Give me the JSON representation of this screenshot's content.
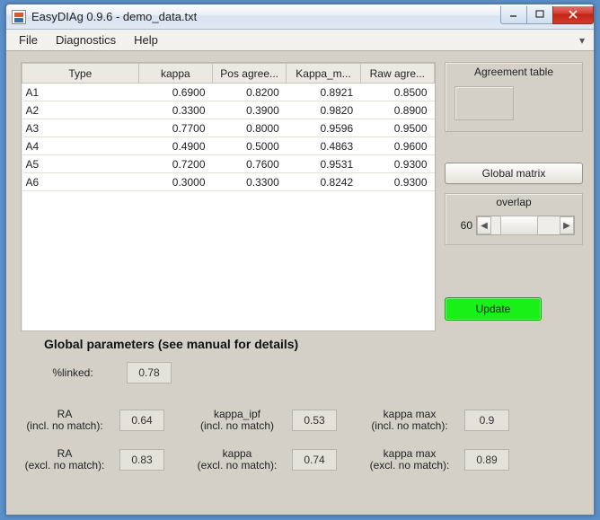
{
  "window": {
    "title": "EasyDIAg 0.9.6 - demo_data.txt"
  },
  "menu": {
    "file": "File",
    "diagnostics": "Diagnostics",
    "help": "Help"
  },
  "table": {
    "headers": {
      "type": "Type",
      "kappa": "kappa",
      "pos_agree": "Pos agree...",
      "kappa_m": "Kappa_m...",
      "raw_agree": "Raw agre..."
    },
    "rows": [
      {
        "type": "A1",
        "kappa": "0.6900",
        "pos": "0.8200",
        "km": "0.8921",
        "raw": "0.8500"
      },
      {
        "type": "A2",
        "kappa": "0.3300",
        "pos": "0.3900",
        "km": "0.9820",
        "raw": "0.8900"
      },
      {
        "type": "A3",
        "kappa": "0.7700",
        "pos": "0.8000",
        "km": "0.9596",
        "raw": "0.9500"
      },
      {
        "type": "A4",
        "kappa": "0.4900",
        "pos": "0.5000",
        "km": "0.4863",
        "raw": "0.9600"
      },
      {
        "type": "A5",
        "kappa": "0.7200",
        "pos": "0.7600",
        "km": "0.9531",
        "raw": "0.9300"
      },
      {
        "type": "A6",
        "kappa": "0.3000",
        "pos": "0.3300",
        "km": "0.8242",
        "raw": "0.9300"
      }
    ]
  },
  "side": {
    "agreement_title": "Agreement table",
    "global_matrix": "Global matrix",
    "overlap_label": "overlap",
    "overlap_value": "60",
    "update": "Update"
  },
  "params": {
    "section_title": "Global parameters (see manual for details)",
    "pct_linked_label": "%linked:",
    "pct_linked": "0.78",
    "ra_incl_label": "RA\n(incl. no match):",
    "ra_incl": "0.64",
    "kappa_ipf_label": "kappa_ipf\n(incl. no match)",
    "kappa_ipf": "0.53",
    "kappa_max_incl_label": "kappa max\n(incl. no match):",
    "kappa_max_incl": "0.9",
    "ra_excl_label": "RA\n(excl. no match):",
    "ra_excl": "0.83",
    "kappa_excl_label": "kappa\n(excl. no match):",
    "kappa_excl": "0.74",
    "kappa_max_excl_label": "kappa max\n(excl. no match):",
    "kappa_max_excl": "0.89"
  }
}
